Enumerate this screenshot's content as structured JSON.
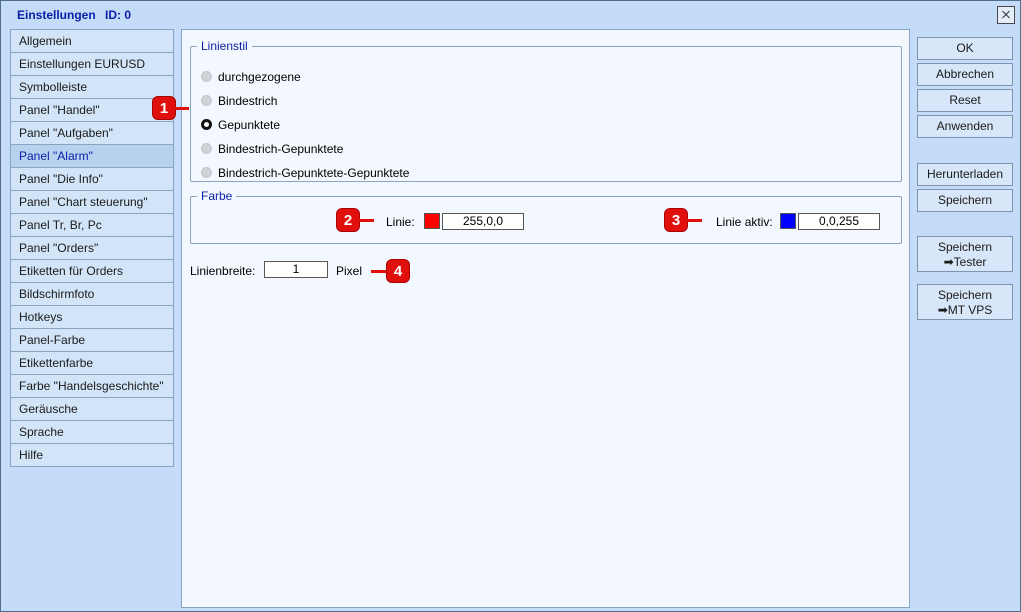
{
  "window": {
    "title": "Einstellungen",
    "id_label": "ID: 0"
  },
  "sidebar": {
    "items": [
      {
        "label": "Allgemein"
      },
      {
        "label": "Einstellungen EURUSD"
      },
      {
        "label": "Symbolleiste"
      },
      {
        "label": "Panel \"Handel\""
      },
      {
        "label": "Panel \"Aufgaben\""
      },
      {
        "label": "Panel \"Alarm\""
      },
      {
        "label": "Panel \"Die Info\""
      },
      {
        "label": "Panel \"Chart steuerung\""
      },
      {
        "label": "Panel Tr, Br, Pc"
      },
      {
        "label": "Panel \"Orders\""
      },
      {
        "label": "Etiketten für Orders"
      },
      {
        "label": "Bildschirmfoto"
      },
      {
        "label": "Hotkeys"
      },
      {
        "label": "Panel-Farbe"
      },
      {
        "label": "Etikettenfarbe"
      },
      {
        "label": "Farbe \"Handelsgeschichte\""
      },
      {
        "label": "Geräusche"
      },
      {
        "label": "Sprache"
      },
      {
        "label": "Hilfe"
      }
    ],
    "active": "Panel \"Alarm\""
  },
  "linienstil": {
    "legend": "Linienstil",
    "options": [
      {
        "label": "durchgezogene",
        "selected": false
      },
      {
        "label": "Bindestrich",
        "selected": false
      },
      {
        "label": "Gepunktete",
        "selected": true
      },
      {
        "label": "Bindestrich-Gepunktete",
        "selected": false
      },
      {
        "label": "Bindestrich-Gepunktete-Gepunktete",
        "selected": false
      }
    ]
  },
  "farbe": {
    "legend": "Farbe",
    "linie": {
      "label": "Linie:",
      "color": "#ff0000",
      "value": "255,0,0"
    },
    "linie_aktiv": {
      "label": "Linie aktiv:",
      "color": "#0000ff",
      "value": "0,0,255"
    }
  },
  "linienbreite": {
    "label": "Linienbreite:",
    "value": "1",
    "unit": "Pixel"
  },
  "markers": [
    "1",
    "2",
    "3",
    "4"
  ],
  "buttons": {
    "ok": "OK",
    "abbrechen": "Abbrechen",
    "reset": "Reset",
    "anwenden": "Anwenden",
    "herunterladen": "Herunterladen",
    "speichern": "Speichern",
    "speichern_tester_line1": "Speichern",
    "speichern_tester_line2": "➡Tester",
    "speichern_vps_line1": "Speichern",
    "speichern_vps_line2": "➡MT VPS"
  },
  "colors": {
    "accent": "#0a1ea8",
    "marker": "#e0110d",
    "window_bg": "#c4dcf8"
  }
}
